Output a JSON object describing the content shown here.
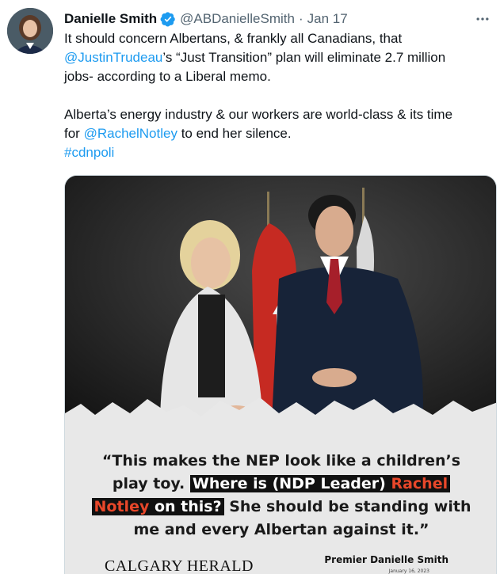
{
  "tweet": {
    "author_name": "Danielle Smith",
    "handle": "@ABDanielleSmith",
    "separator": "·",
    "date": "Jan 17",
    "verified_icon": "verified-badge-icon",
    "more_icon": "more-horizontal-icon",
    "line1_a": "It should concern Albertans, & frankly all Canadians, that",
    "mention1": "@JustinTrudeau",
    "line2_b": "’s “Just Transition” plan will eliminate 2.7 million",
    "line3": "jobs- according to a Liberal memo.",
    "line4": "Alberta’s energy industry & our workers are world-class & its time",
    "line5_a": "for",
    "mention2": "@RachelNotley",
    "line5_b": "to end her silence.",
    "hashtag": "#cdnpoli"
  },
  "media": {
    "quote_line1": "“This makes the NEP look like a children’s",
    "quote_line2_a": "play toy.",
    "quote_hl2_a": "Where is (NDP Leader)",
    "quote_hl2_red": "Rachel",
    "quote_hl3_red": "Notley",
    "quote_hl3_b": "on this?",
    "quote_line3_b": "She should be standing with",
    "quote_line4": "me and every Albertan against it.”",
    "paper_name": "CALGARY HERALD",
    "byline": "Premier Danielle Smith",
    "byline_date": "January 16, 2023"
  },
  "colors": {
    "link": "#1d9bf0",
    "secondary_text": "#536471",
    "highlight_bg": "#111111",
    "highlight_red": "#e8472a"
  }
}
